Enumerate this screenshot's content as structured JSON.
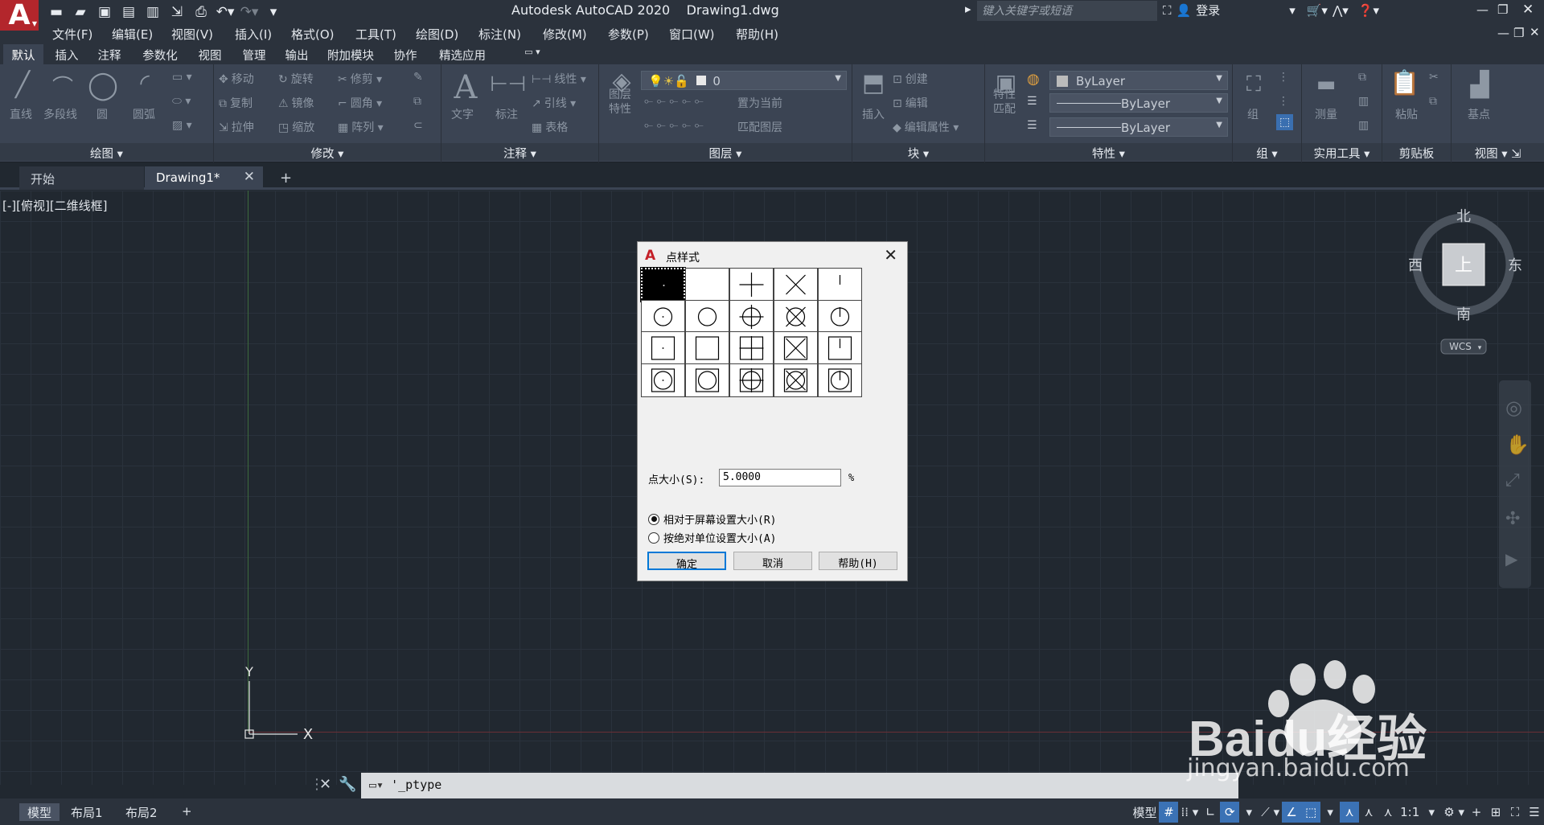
{
  "app": {
    "logo": "A",
    "window_title": "Autodesk AutoCAD 2020    Drawing1.dwg",
    "search_placeholder": "键入关键字或短语",
    "login": "登录"
  },
  "quick_access": [
    "new-icon",
    "open-icon",
    "save-icon",
    "saveas-icon",
    "open-web-icon",
    "save-web-icon",
    "plot-icon",
    "undo-icon",
    "redo-icon",
    "customize-icon"
  ],
  "menu": [
    "文件(F)",
    "编辑(E)",
    "视图(V)",
    "插入(I)",
    "格式(O)",
    "工具(T)",
    "绘图(D)",
    "标注(N)",
    "修改(M)",
    "参数(P)",
    "窗口(W)",
    "帮助(H)"
  ],
  "ribbon_tabs": [
    "默认",
    "插入",
    "注释",
    "参数化",
    "视图",
    "管理",
    "输出",
    "附加模块",
    "协作",
    "精选应用"
  ],
  "ribbon": {
    "draw": {
      "title": "绘图",
      "line": "直线",
      "polyline": "多段线",
      "circle": "圆",
      "arc": "圆弧"
    },
    "modify": {
      "title": "修改",
      "move": "移动",
      "rotate": "旋转",
      "trim": "修剪",
      "copy": "复制",
      "mirror": "镜像",
      "fillet": "圆角",
      "stretch": "拉伸",
      "scale": "缩放",
      "array": "阵列"
    },
    "annotation": {
      "title": "注释",
      "text": "文字",
      "dimension": "标注",
      "linear": "线性",
      "leader": "引线",
      "table": "表格"
    },
    "layers": {
      "title": "图层",
      "props1": "图层",
      "props2": "特性",
      "current_layer": "0",
      "make_current": "置为当前",
      "match_layer": "匹配图层"
    },
    "block": {
      "title": "块",
      "insert": "插入",
      "create": "创建",
      "edit": "编辑",
      "edit_attr": "编辑属性"
    },
    "properties": {
      "title": "特性",
      "match1": "特性",
      "match2": "匹配",
      "color": "ByLayer",
      "linetype": "ByLayer",
      "lineweight": "ByLayer"
    },
    "groups": {
      "title": "组",
      "group": "组"
    },
    "utilities": {
      "title": "实用工具",
      "measure": "测量"
    },
    "clipboard": {
      "title": "剪贴板",
      "paste": "粘贴"
    },
    "view": {
      "title": "视图",
      "base": "基点"
    }
  },
  "doc_tabs": {
    "start": "开始",
    "active": "Drawing1*"
  },
  "viewport": {
    "label": "[-][俯视][二维线框]"
  },
  "viewcube": {
    "north": "北",
    "south": "南",
    "east": "东",
    "west": "西",
    "top": "上",
    "wcs": "WCS"
  },
  "ucs": {
    "x": "X",
    "y": "Y"
  },
  "dialog": {
    "title": "点样式",
    "selected_index": 0,
    "size_label": "点大小(S):",
    "size_value": "5.0000",
    "unit": "%",
    "radio_relative": "相对于屏幕设置大小(R)",
    "radio_absolute": "按绝对单位设置大小(A)",
    "selected_mode": "relative",
    "ok": "确定",
    "cancel": "取消",
    "help": "帮助(H)"
  },
  "command_line": {
    "text": "'_ptype"
  },
  "layout_tabs": [
    "模型",
    "布局1",
    "布局2"
  ],
  "status": {
    "model": "模型",
    "scale": "1:1"
  },
  "watermark": {
    "brand": "Baidu经验",
    "url": "jingyan.baidu.com"
  }
}
